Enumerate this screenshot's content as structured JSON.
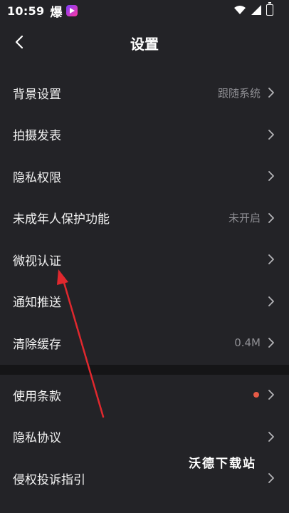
{
  "status_bar": {
    "time": "10:59",
    "app_icon_glyph": "爆",
    "icons": [
      "video-app-icon",
      "wifi-icon",
      "signal-icon",
      "battery-icon"
    ]
  },
  "header": {
    "title": "设置",
    "back_icon": "chevron-left-icon"
  },
  "settings_group_1": [
    {
      "label": "背景设置",
      "value": "跟随系统"
    },
    {
      "label": "拍摄发表",
      "value": ""
    },
    {
      "label": "隐私权限",
      "value": ""
    },
    {
      "label": "未成年人保护功能",
      "value": "未开启"
    },
    {
      "label": "微视认证",
      "value": ""
    },
    {
      "label": "通知推送",
      "value": ""
    },
    {
      "label": "清除缓存",
      "value": "0.4M"
    }
  ],
  "settings_group_2": [
    {
      "label": "使用条款",
      "badge": "red-dot"
    },
    {
      "label": "隐私协议"
    },
    {
      "label": "侵权投诉指引"
    }
  ],
  "watermark": "沃德下载站",
  "colors": {
    "background": "#232327",
    "divider": "#151517",
    "secondary_text": "#8e8e93",
    "badge_red": "#e55a46",
    "annotation_arrow": "#e0282e"
  }
}
